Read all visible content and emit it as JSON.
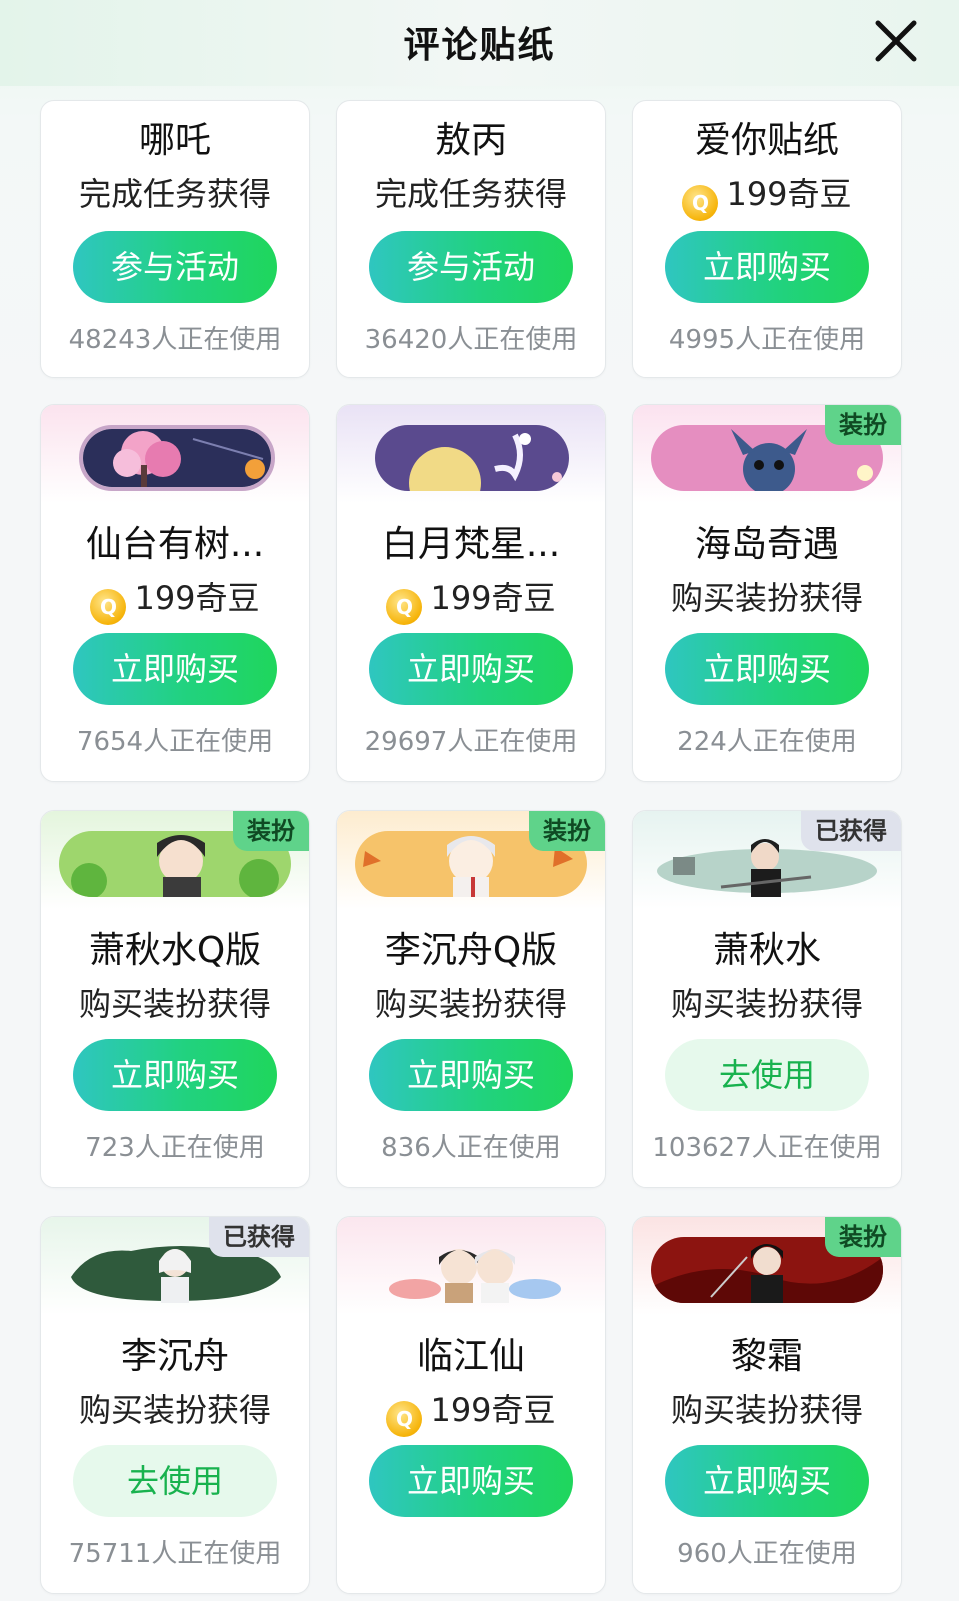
{
  "header": {
    "title": "评论贴纸"
  },
  "icons": {
    "close": "close-icon",
    "coin": "coin-icon"
  },
  "colors": {
    "button_gradient": [
      "#2fc6c0",
      "#1fd65c"
    ],
    "use_button_bg": "#e6f9ec",
    "use_button_text": "#18b24e",
    "badge_green": "#5fd38a",
    "badge_gray": "#dfe2ec"
  },
  "coin_symbol": "Q",
  "stickers": [
    {
      "name": "哪吒",
      "sub": "完成任务获得",
      "coin": false,
      "button": "参与活动",
      "button_style": "primary",
      "users": "48243人正在使用",
      "badge": ""
    },
    {
      "name": "敖丙",
      "sub": "完成任务获得",
      "coin": false,
      "button": "参与活动",
      "button_style": "primary",
      "users": "36420人正在使用",
      "badge": ""
    },
    {
      "name": "爱你贴纸",
      "sub": "199奇豆",
      "coin": true,
      "button": "立即购买",
      "button_style": "primary",
      "users": "4995人正在使用",
      "badge": ""
    },
    {
      "name": "仙台有树...",
      "sub": "199奇豆",
      "coin": true,
      "button": "立即购买",
      "button_style": "primary",
      "users": "7654人正在使用",
      "badge": ""
    },
    {
      "name": "白月梵星...",
      "sub": "199奇豆",
      "coin": true,
      "button": "立即购买",
      "button_style": "primary",
      "users": "29697人正在使用",
      "badge": ""
    },
    {
      "name": "海岛奇遇",
      "sub": "购买装扮获得",
      "coin": false,
      "button": "立即购买",
      "button_style": "primary",
      "users": "224人正在使用",
      "badge": "装扮"
    },
    {
      "name": "萧秋水Q版",
      "sub": "购买装扮获得",
      "coin": false,
      "button": "立即购买",
      "button_style": "primary",
      "users": "723人正在使用",
      "badge": "装扮"
    },
    {
      "name": "李沉舟Q版",
      "sub": "购买装扮获得",
      "coin": false,
      "button": "立即购买",
      "button_style": "primary",
      "users": "836人正在使用",
      "badge": "装扮"
    },
    {
      "name": "萧秋水",
      "sub": "购买装扮获得",
      "coin": false,
      "button": "去使用",
      "button_style": "light",
      "users": "103627人正在使用",
      "badge": "已获得"
    },
    {
      "name": "李沉舟",
      "sub": "购买装扮获得",
      "coin": false,
      "button": "去使用",
      "button_style": "light",
      "users": "75711人正在使用",
      "badge": "已获得"
    },
    {
      "name": "临江仙",
      "sub": "199奇豆",
      "coin": true,
      "button": "立即购买",
      "button_style": "primary",
      "users": "",
      "badge": ""
    },
    {
      "name": "黎霜",
      "sub": "购买装扮获得",
      "coin": false,
      "button": "立即购买",
      "button_style": "primary",
      "users": "960人正在使用",
      "badge": "装扮"
    }
  ]
}
